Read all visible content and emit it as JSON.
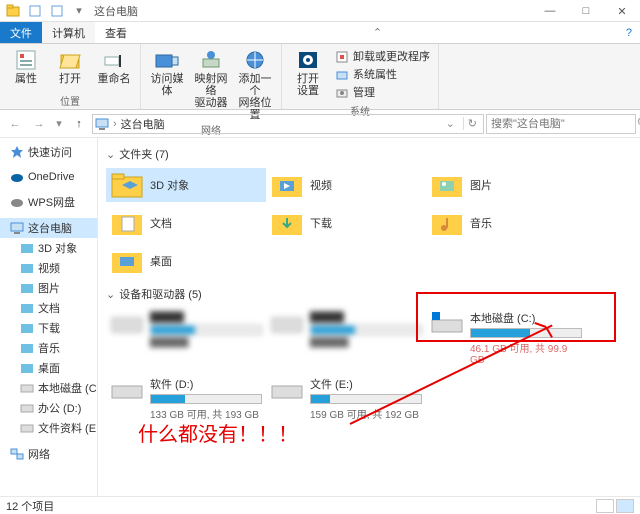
{
  "window": {
    "title": "这台电脑",
    "min": "—",
    "max": "□",
    "close": "✕"
  },
  "tabs": {
    "file": "文件",
    "computer": "计算机",
    "view": "查看"
  },
  "ribbon": {
    "loc": {
      "props": "属性",
      "open": "打开",
      "rename": "重命名",
      "group": "位置"
    },
    "net": {
      "media": "访问媒体",
      "mapdrv": "映射网络\n驱动器",
      "addloc": "添加一个\n网络位置",
      "group": "网络"
    },
    "sys": {
      "settings": "打开\n设置",
      "uninstall": "卸载或更改程序",
      "sysprops": "系统属性",
      "manage": "管理",
      "group": "系统"
    }
  },
  "nav": {
    "crumb": "这台电脑",
    "search_ph": "搜索\"这台电脑\""
  },
  "tree": {
    "quick": "快速访问",
    "onedrive": "OneDrive",
    "wps": "WPS网盘",
    "thispc": "这台电脑",
    "obj3d": "3D 对象",
    "video": "视频",
    "pics": "图片",
    "docs": "文档",
    "down": "下载",
    "music": "音乐",
    "desk": "桌面",
    "cdrive": "本地磁盘 (C:)",
    "ddrive": "办公 (D:)",
    "edrive": "文件资料 (E:)",
    "network": "网络"
  },
  "content": {
    "folders_hdr": "文件夹 (7)",
    "folders": {
      "obj3d": "3D 对象",
      "video": "视频",
      "pics": "图片",
      "docs": "文档",
      "down": "下载",
      "music": "音乐",
      "desk": "桌面"
    },
    "drives_hdr": "设备和驱动器 (5)",
    "drives": {
      "c": {
        "name": "本地磁盘 (C:)",
        "sub": "46.1 GB 可用, 共 99.9 GB",
        "pct": 54
      },
      "d": {
        "name": "软件 (D:)",
        "sub": "133 GB 可用, 共 193 GB",
        "pct": 31
      },
      "e": {
        "name": "文件 (E:)",
        "sub": "159 GB 可用, 共 192 GB",
        "pct": 17
      }
    }
  },
  "annotation": "什么都没有！！！",
  "status": {
    "count": "12 个项目"
  }
}
